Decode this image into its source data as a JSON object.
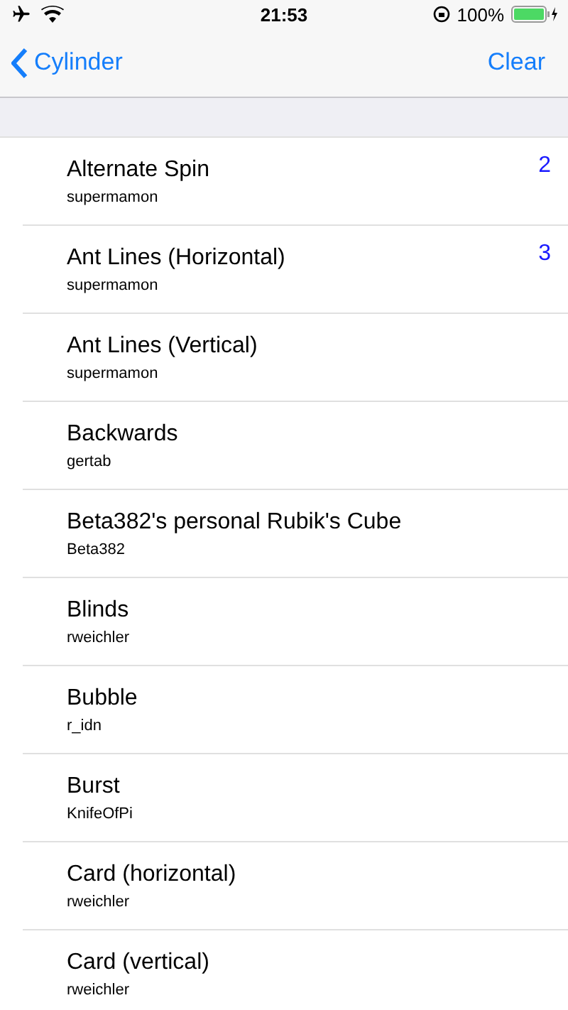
{
  "status_bar": {
    "time": "21:53",
    "battery": "100%"
  },
  "nav": {
    "back": "Cylinder",
    "action": "Clear"
  },
  "rows": [
    {
      "title": "Alternate Spin",
      "author": "supermamon",
      "count": "2"
    },
    {
      "title": "Ant Lines (Horizontal)",
      "author": "supermamon",
      "count": "3"
    },
    {
      "title": "Ant Lines (Vertical)",
      "author": "supermamon"
    },
    {
      "title": "Backwards",
      "author": "gertab"
    },
    {
      "title": "Beta382's personal Rubik's Cube",
      "author": "Beta382"
    },
    {
      "title": "Blinds",
      "author": "rweichler"
    },
    {
      "title": "Bubble",
      "author": "r_idn"
    },
    {
      "title": "Burst",
      "author": "KnifeOfPi"
    },
    {
      "title": "Card (horizontal)",
      "author": "rweichler"
    },
    {
      "title": "Card (vertical)",
      "author": "rweichler"
    }
  ]
}
